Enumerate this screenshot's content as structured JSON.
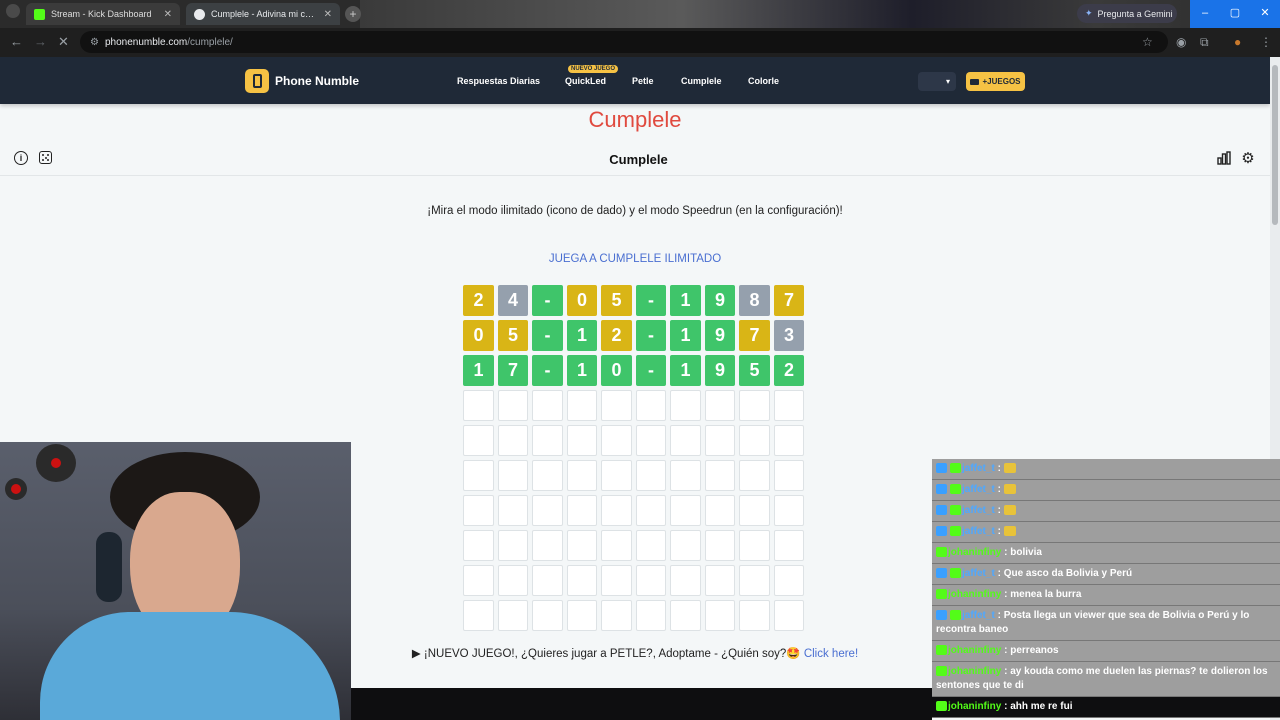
{
  "browser": {
    "tabs": [
      {
        "title": "Stream - Kick Dashboard",
        "active": false
      },
      {
        "title": "Cumplele - Adivina mi cumpleaños",
        "active": true
      }
    ],
    "gemini_label": "Pregunta a Gemini",
    "url_host": "phonenumble.com",
    "url_path": "/cumplele/"
  },
  "site": {
    "name": "Phone Numble",
    "nav": [
      "Respuestas Diarias",
      "QuickLed",
      "Petle",
      "Cumplele",
      "Colorle"
    ],
    "new_badge": "NUEVO JUEGO",
    "plus_label": "+JUEGOS",
    "select_arrow": "▾"
  },
  "page": {
    "title": "Cumplele",
    "game_title": "Cumplele",
    "promo": "¡Mira el modo ilimitado (icono de dado) y el modo Speedrun (en la configuración)!",
    "unlimited_link": "JUEGA A CUMPLELE ILIMITADO",
    "footer_text": "▶ ¡NUEVO JUEGO!, ¿Quieres jugar a PETLE?, Adoptame - ¿Quién soy?🤩",
    "footer_link": "Click here!"
  },
  "grid": {
    "rows": [
      {
        "cells": [
          {
            "v": "2",
            "s": "y"
          },
          {
            "v": "4",
            "s": "x"
          },
          {
            "v": "-",
            "s": "g"
          },
          {
            "v": "0",
            "s": "y"
          },
          {
            "v": "5",
            "s": "y"
          },
          {
            "v": "-",
            "s": "g"
          },
          {
            "v": "1",
            "s": "g"
          },
          {
            "v": "9",
            "s": "g"
          },
          {
            "v": "8",
            "s": "x"
          },
          {
            "v": "7",
            "s": "y"
          }
        ]
      },
      {
        "cells": [
          {
            "v": "0",
            "s": "y"
          },
          {
            "v": "5",
            "s": "y"
          },
          {
            "v": "-",
            "s": "g"
          },
          {
            "v": "1",
            "s": "g"
          },
          {
            "v": "2",
            "s": "y"
          },
          {
            "v": "-",
            "s": "g"
          },
          {
            "v": "1",
            "s": "g"
          },
          {
            "v": "9",
            "s": "g"
          },
          {
            "v": "7",
            "s": "y"
          },
          {
            "v": "3",
            "s": "x"
          }
        ]
      },
      {
        "cells": [
          {
            "v": "1",
            "s": "g"
          },
          {
            "v": "7",
            "s": "g"
          },
          {
            "v": "-",
            "s": "g"
          },
          {
            "v": "1",
            "s": "g"
          },
          {
            "v": "0",
            "s": "g"
          },
          {
            "v": "-",
            "s": "g"
          },
          {
            "v": "1",
            "s": "g"
          },
          {
            "v": "9",
            "s": "g"
          },
          {
            "v": "5",
            "s": "g"
          },
          {
            "v": "2",
            "s": "g"
          }
        ]
      }
    ],
    "empty_rows": 7,
    "columns": 10,
    "colors": {
      "correct": "#3fc56a",
      "present": "#d9b516",
      "absent": "#95a0ad"
    }
  },
  "chat": {
    "messages": [
      {
        "user": "jaffet_t",
        "text": "",
        "emote": true,
        "color": "blue"
      },
      {
        "user": "jaffet_t",
        "text": "",
        "emote": true,
        "color": "blue"
      },
      {
        "user": "jaffet_t",
        "text": "",
        "emote": true,
        "color": "blue"
      },
      {
        "user": "jaffet_t",
        "text": "",
        "emote": true,
        "color": "blue"
      },
      {
        "user": "johaninfiny",
        "text": "bolivia",
        "emote": false,
        "color": "green"
      },
      {
        "user": "jaffet_t",
        "text": "Que asco da Bolivia y Perú",
        "emote": false,
        "color": "blue"
      },
      {
        "user": "johaninfiny",
        "text": "menea la burra",
        "emote": false,
        "color": "green"
      },
      {
        "user": "jaffet_t",
        "text": "Posta llega un viewer que sea de Bolivia o Perú y lo recontra baneo",
        "emote": false,
        "color": "blue"
      },
      {
        "user": "johaninfiny",
        "text": "perreanos",
        "emote": false,
        "color": "green"
      },
      {
        "user": "johaninfiny",
        "text": "ay kouda como me duelen las piernas? te dolieron los sentones que te di",
        "emote": false,
        "color": "green"
      },
      {
        "user": "johaninfiny",
        "text": "ahh me re fui",
        "emote": false,
        "color": "green"
      }
    ]
  }
}
